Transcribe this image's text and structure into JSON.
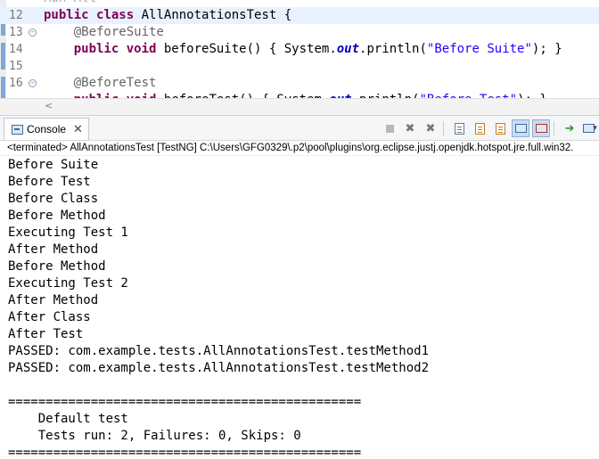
{
  "editor": {
    "lines": [
      {
        "num": "",
        "fold": false,
        "segments": [
          {
            "t": "Run All",
            "c": "faded"
          }
        ]
      },
      {
        "num": "12",
        "fold": false,
        "current": true,
        "segments": [
          {
            "t": "public",
            "c": "kw"
          },
          {
            "t": " "
          },
          {
            "t": "class",
            "c": "kw"
          },
          {
            "t": " AllAnnotationsTest {"
          }
        ]
      },
      {
        "num": "13",
        "fold": true,
        "segments": [
          {
            "t": "    "
          },
          {
            "t": "@BeforeSuite",
            "c": "ann"
          }
        ]
      },
      {
        "num": "14",
        "fold": false,
        "segments": [
          {
            "t": "    "
          },
          {
            "t": "public",
            "c": "kw"
          },
          {
            "t": " "
          },
          {
            "t": "void",
            "c": "kw"
          },
          {
            "t": " beforeSuite() { System."
          },
          {
            "t": "out",
            "c": "fld"
          },
          {
            "t": ".println("
          },
          {
            "t": "\"Before Suite\"",
            "c": "str"
          },
          {
            "t": "); }"
          }
        ]
      },
      {
        "num": "15",
        "fold": false,
        "segments": [
          {
            "t": ""
          }
        ]
      },
      {
        "num": "16",
        "fold": true,
        "segments": [
          {
            "t": "    "
          },
          {
            "t": "@BeforeTest",
            "c": "ann"
          }
        ]
      },
      {
        "num": "",
        "fold": false,
        "segments": [
          {
            "t": "    "
          },
          {
            "t": "public",
            "c": "kw"
          },
          {
            "t": " "
          },
          {
            "t": "void",
            "c": "kw"
          },
          {
            "t": " beforeTest() { System."
          },
          {
            "t": "out",
            "c": "fld"
          },
          {
            "t": ".println("
          },
          {
            "t": "\"Before Test\"",
            "c": "str"
          },
          {
            "t": "); }"
          }
        ]
      }
    ],
    "scroll_arrow": "<"
  },
  "console": {
    "tab_label": "Console",
    "tab_close": "✕",
    "toolbar_icons": [
      "terminate-icon",
      "remove-launch-icon",
      "remove-all-terminated-icon",
      "clear-console-icon",
      "scroll-lock-icon",
      "word-wrap-icon",
      "show-on-stdout-icon",
      "show-on-stderr-icon",
      "pin-console-icon",
      "display-selected-console-icon"
    ],
    "status": "<terminated> AllAnnotationsTest [TestNG] C:\\Users\\GFG0329\\.p2\\pool\\plugins\\org.eclipse.justj.openjdk.hotspot.jre.full.win32.",
    "output": [
      "Before Suite",
      "Before Test",
      "Before Class",
      "Before Method",
      "Executing Test 1",
      "After Method",
      "Before Method",
      "Executing Test 2",
      "After Method",
      "After Class",
      "After Test",
      "PASSED: com.example.tests.AllAnnotationsTest.testMethod1",
      "PASSED: com.example.tests.AllAnnotationsTest.testMethod2",
      "",
      "===============================================",
      "    Default test",
      "    Tests run: 2, Failures: 0, Skips: 0",
      "==============================================="
    ]
  }
}
